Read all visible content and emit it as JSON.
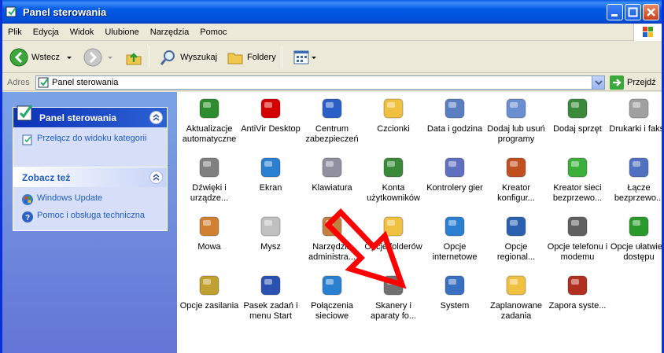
{
  "window": {
    "title": "Panel sterowania"
  },
  "menu": [
    "Plik",
    "Edycja",
    "Widok",
    "Ulubione",
    "Narzędzia",
    "Pomoc"
  ],
  "toolbar": {
    "back": "Wstecz",
    "search": "Wyszukaj",
    "folders": "Foldery"
  },
  "address": {
    "label": "Adres",
    "value": "Panel sterowania",
    "go": "Przejdź"
  },
  "leftpane": {
    "cp_title": "Panel sterowania",
    "switch_view": "Przełącz do widoku kategorii",
    "see_also_title": "Zobacz też",
    "see_also": [
      "Windows Update",
      "Pomoc i obsługa techniczna"
    ]
  },
  "items": [
    {
      "label": "Aktualizacje automatyczne",
      "icon": "windows-update-icon",
      "color": "#2d8c2d"
    },
    {
      "label": "AntiVir Desktop",
      "icon": "antivir-icon",
      "color": "#d40000"
    },
    {
      "label": "Centrum zabezpieczeń",
      "icon": "shield-icon",
      "color": "#2a5fc7"
    },
    {
      "label": "Czcionki",
      "icon": "fonts-folder-icon",
      "color": "#f0c040"
    },
    {
      "label": "Data i godzina",
      "icon": "clock-icon",
      "color": "#5a7fc0"
    },
    {
      "label": "Dodaj lub usuń programy",
      "icon": "add-remove-icon",
      "color": "#6a8fd0"
    },
    {
      "label": "Dodaj sprzęt",
      "icon": "hardware-icon",
      "color": "#3a8a3a"
    },
    {
      "label": "Drukarki i faksy",
      "icon": "printer-icon",
      "color": "#a0a0a0"
    },
    {
      "label": "Dźwięki i urządze...",
      "icon": "speaker-icon",
      "color": "#808080"
    },
    {
      "label": "Ekran",
      "icon": "display-icon",
      "color": "#2a7fd0"
    },
    {
      "label": "Klawiatura",
      "icon": "keyboard-icon",
      "color": "#9090a0"
    },
    {
      "label": "Konta użytkowników",
      "icon": "users-icon",
      "color": "#3a8a3a"
    },
    {
      "label": "Kontrolery gier",
      "icon": "gamepad-icon",
      "color": "#6070c0"
    },
    {
      "label": "Kreator konfigur...",
      "icon": "network-house-icon",
      "color": "#c05020"
    },
    {
      "label": "Kreator sieci bezprzewo...",
      "icon": "wireless-icon",
      "color": "#3ab03a"
    },
    {
      "label": "Łącze bezprzewo...",
      "icon": "wireless-link-icon",
      "color": "#5070c0"
    },
    {
      "label": "Mowa",
      "icon": "speech-icon",
      "color": "#d08030"
    },
    {
      "label": "Mysz",
      "icon": "mouse-icon",
      "color": "#c0c0c0"
    },
    {
      "label": "Narzędzia administra...",
      "icon": "admin-tools-icon",
      "color": "#c08040"
    },
    {
      "label": "Opcje folderów",
      "icon": "folder-options-icon",
      "color": "#f0c040"
    },
    {
      "label": "Opcje internetowe",
      "icon": "internet-options-icon",
      "color": "#2a7fd0"
    },
    {
      "label": "Opcje regional...",
      "icon": "globe-icon",
      "color": "#2a60b0"
    },
    {
      "label": "Opcje telefonu i modemu",
      "icon": "phone-icon",
      "color": "#606060"
    },
    {
      "label": "Opcje ułatwień dostępu",
      "icon": "accessibility-icon",
      "color": "#2a9a2a"
    },
    {
      "label": "Opcje zasilania",
      "icon": "power-icon",
      "color": "#c0a030"
    },
    {
      "label": "Pasek zadań i menu Start",
      "icon": "taskbar-icon",
      "color": "#2a50b0"
    },
    {
      "label": "Połączenia sieciowe",
      "icon": "network-connections-icon",
      "color": "#2a80d0"
    },
    {
      "label": "Skanery i aparaty fo...",
      "icon": "scanner-icon",
      "color": "#707070"
    },
    {
      "label": "System",
      "icon": "system-icon",
      "color": "#3a70c0"
    },
    {
      "label": "Zaplanowane zadania",
      "icon": "scheduled-tasks-icon",
      "color": "#f0c040"
    },
    {
      "label": "Zapora syste...",
      "icon": "firewall-icon",
      "color": "#b03020"
    }
  ]
}
